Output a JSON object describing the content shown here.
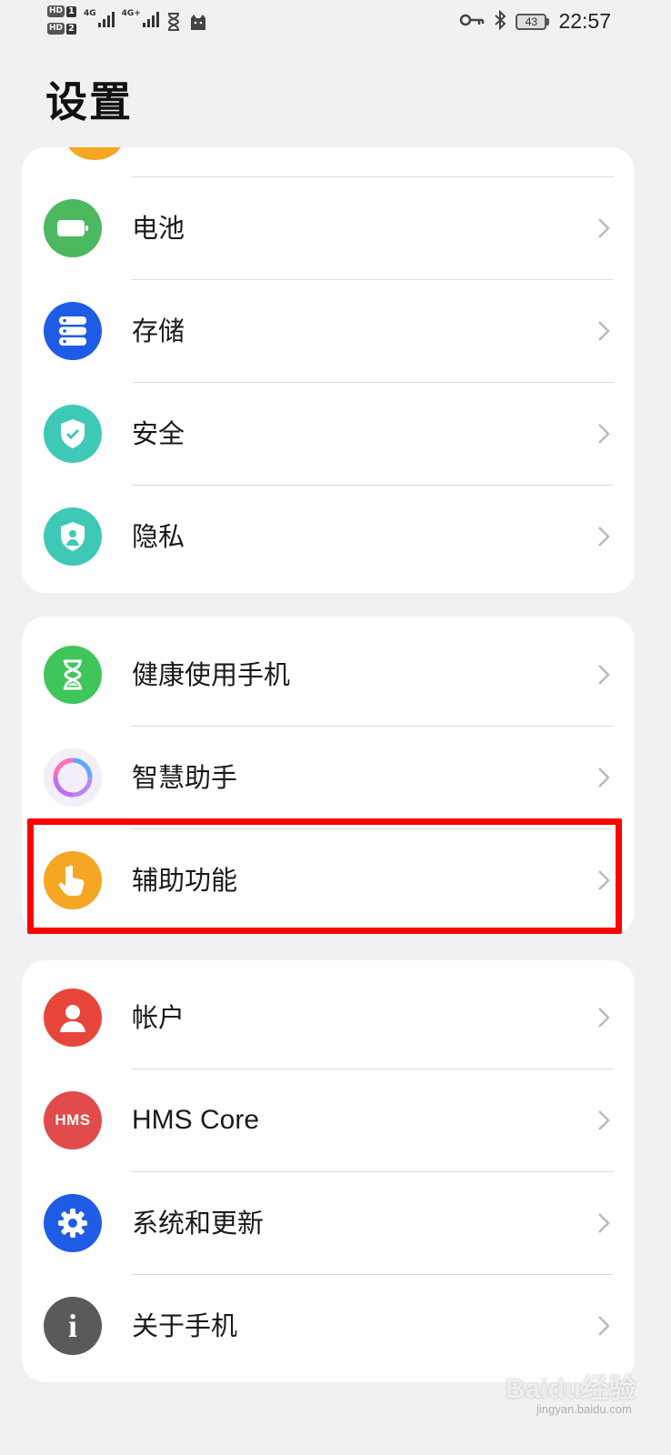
{
  "status_bar": {
    "hd1": "HD",
    "hd1_num": "1",
    "hd2": "HD",
    "hd2_num": "2",
    "net1": "4G",
    "net2": "4G+",
    "battery_level": "43",
    "time": "22:57"
  },
  "header": {
    "title": "设置"
  },
  "colors": {
    "battery_green": "#4cb85f",
    "storage_blue": "#1f5ce6",
    "security_teal": "#3ec9b7",
    "privacy_teal": "#3ec9b7",
    "digital_balance_green": "#3fc65a",
    "accessibility_orange": "#f5a623",
    "account_red": "#e8463a",
    "hms_red": "#e24b4b",
    "system_blue": "#1f5ce6",
    "about_gray": "#5a5a5a",
    "highlight_red": "#ff0000"
  },
  "sections": [
    {
      "items": [
        {
          "label": "电池",
          "icon": "battery-icon"
        },
        {
          "label": "存储",
          "icon": "storage-icon"
        },
        {
          "label": "安全",
          "icon": "shield-check-icon"
        },
        {
          "label": "隐私",
          "icon": "privacy-shield-icon"
        }
      ]
    },
    {
      "items": [
        {
          "label": "健康使用手机",
          "icon": "hourglass-icon"
        },
        {
          "label": "智慧助手",
          "icon": "assistant-ring-icon"
        },
        {
          "label": "辅助功能",
          "icon": "hand-pointer-icon"
        }
      ]
    },
    {
      "items": [
        {
          "label": "帐户",
          "icon": "person-icon"
        },
        {
          "label": "HMS Core",
          "icon": "hms-icon",
          "icon_text": "HMS"
        },
        {
          "label": "系统和更新",
          "icon": "gear-icon"
        },
        {
          "label": "关于手机",
          "icon": "info-icon",
          "icon_text": "i"
        }
      ]
    }
  ],
  "watermark": {
    "brand": "Baidu经验",
    "url": "jingyan.baidu.com"
  }
}
